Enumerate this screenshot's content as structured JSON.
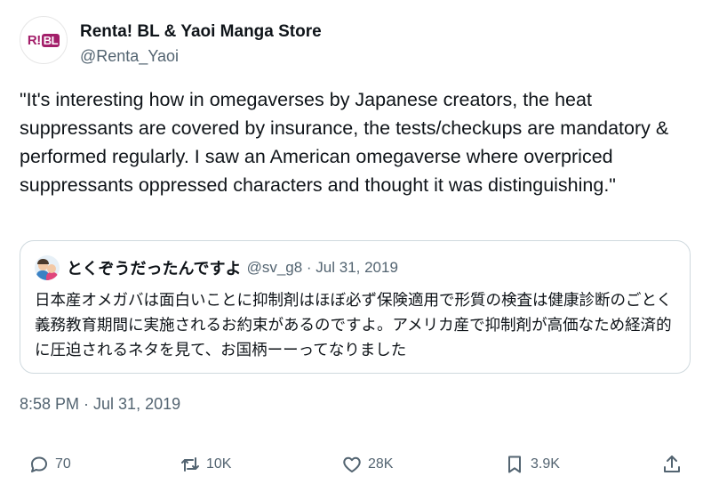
{
  "author": {
    "avatar_text": "R!",
    "avatar_badge": "BL",
    "name": "Renta! BL & Yaoi Manga Store",
    "handle": "@Renta_Yaoi"
  },
  "tweet": {
    "text": "\"It's interesting how in omegaverses by Japanese creators, the heat suppressants are covered by insurance, the tests/checkups are mandatory & performed regularly. I saw an American omegaverse where overpriced suppressants oppressed characters and thought it was distinguishing.\""
  },
  "quoted_tweet": {
    "name": "とくぞうだったんですよ",
    "meta": "@sv_g8 · Jul 31, 2019",
    "text": "日本産オメガバは面白いことに抑制剤はほぼ必ず保険適用で形質の検査は健康診断のごとく義務教育期間に実施されるお約束があるのですよ。アメリカ産で抑制剤が高価なため経済的に圧迫されるネタを見て、お国柄ーーってなりました"
  },
  "timestamp": "8:58 PM · Jul 31, 2019",
  "actions": {
    "replies": "70",
    "retweets": "10K",
    "likes": "28K",
    "bookmarks": "3.9K"
  },
  "icons": {
    "reply": "reply-icon",
    "retweet": "retweet-icon",
    "like": "heart-icon",
    "bookmark": "bookmark-icon",
    "share": "share-icon"
  },
  "colors": {
    "text": "#0f1419",
    "secondary": "#536471",
    "border": "#cfd9de",
    "brand": "#a31f6a"
  }
}
